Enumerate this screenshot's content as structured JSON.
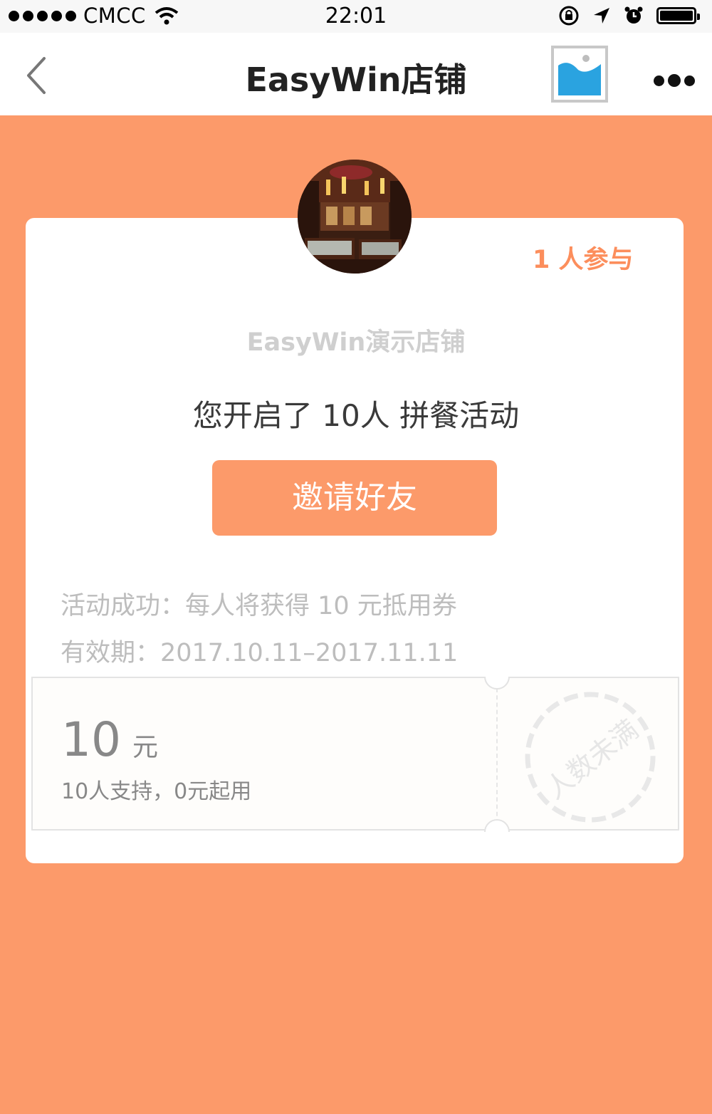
{
  "status_bar": {
    "carrier": "CMCC",
    "time": "22:01"
  },
  "nav": {
    "title": "EasyWin店铺"
  },
  "card": {
    "participants": "1 人参与",
    "shop_name": "EasyWin演示店铺",
    "activity_text": "您开启了 10人 拼餐活动",
    "invite_button": "邀请好友",
    "success_info": "活动成功：每人将获得 10 元抵用券",
    "validity": "有效期：2017.10.11–2017.11.11"
  },
  "coupon": {
    "amount": "10",
    "unit": "元",
    "description": "10人支持，0元起用",
    "stamp": "人数未满"
  },
  "colors": {
    "accent": "#FC9A6A",
    "accent_text": "#FC8E5C"
  }
}
